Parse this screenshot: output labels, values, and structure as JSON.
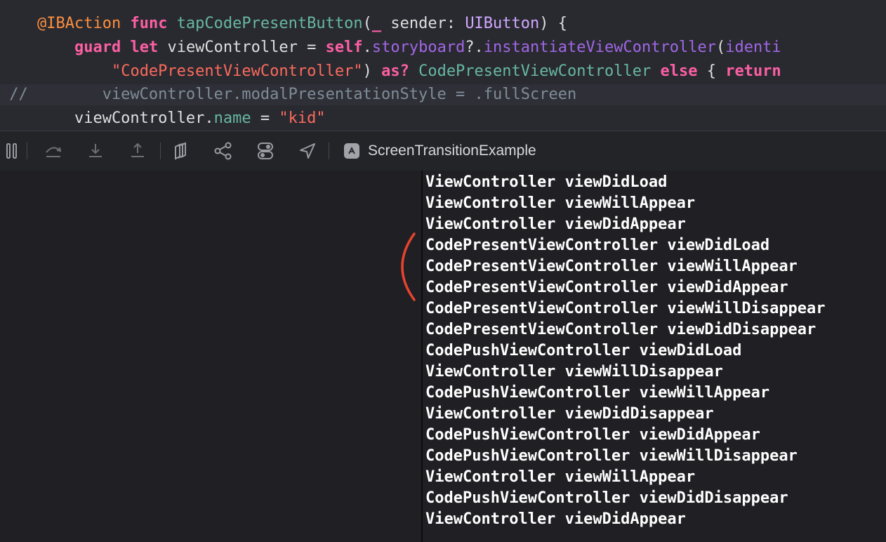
{
  "editor": {
    "lines": [
      {
        "tokens": [
          {
            "t": "    ",
            "c": "plain"
          },
          {
            "t": "@IBAction",
            "c": "attr"
          },
          {
            "t": " ",
            "c": "plain"
          },
          {
            "t": "func",
            "c": "kw"
          },
          {
            "t": " ",
            "c": "plain"
          },
          {
            "t": "tapCodePresentButton",
            "c": "fn"
          },
          {
            "t": "(",
            "c": "plain"
          },
          {
            "t": "_",
            "c": "kw"
          },
          {
            "t": " sender: ",
            "c": "plain"
          },
          {
            "t": "UIButton",
            "c": "type"
          },
          {
            "t": ") {",
            "c": "plain"
          }
        ]
      },
      {
        "tokens": [
          {
            "t": "        ",
            "c": "plain"
          },
          {
            "t": "guard",
            "c": "kw"
          },
          {
            "t": " ",
            "c": "plain"
          },
          {
            "t": "let",
            "c": "kw"
          },
          {
            "t": " viewController = ",
            "c": "plain"
          },
          {
            "t": "self",
            "c": "kw"
          },
          {
            "t": ".",
            "c": "plain"
          },
          {
            "t": "storyboard",
            "c": "prop"
          },
          {
            "t": "?.",
            "c": "plain"
          },
          {
            "t": "instantiateViewController",
            "c": "prop"
          },
          {
            "t": "(",
            "c": "plain"
          },
          {
            "t": "identi",
            "c": "prop"
          }
        ]
      },
      {
        "tokens": [
          {
            "t": "            ",
            "c": "plain"
          },
          {
            "t": "\"CodePresentViewController\"",
            "c": "str"
          },
          {
            "t": ") ",
            "c": "plain"
          },
          {
            "t": "as?",
            "c": "kw"
          },
          {
            "t": " ",
            "c": "plain"
          },
          {
            "t": "CodePresentViewController",
            "c": "fn"
          },
          {
            "t": " ",
            "c": "plain"
          },
          {
            "t": "else",
            "c": "kw"
          },
          {
            "t": " { ",
            "c": "plain"
          },
          {
            "t": "return",
            "c": "kw"
          }
        ]
      },
      {
        "current": true,
        "tokens": [
          {
            "t": " //        viewController.modalPresentationStyle = .fullScreen",
            "c": "cm"
          }
        ]
      },
      {
        "tokens": [
          {
            "t": "        viewController.",
            "c": "plain"
          },
          {
            "t": "name",
            "c": "fn"
          },
          {
            "t": " = ",
            "c": "plain"
          },
          {
            "t": "\"kid\"",
            "c": "str"
          }
        ]
      }
    ]
  },
  "debug_toolbar": {
    "buttons": [
      {
        "icon": "pause-icon",
        "name": "continue-pause-button"
      },
      {
        "icon": "step-over-icon",
        "name": "step-over-button"
      },
      {
        "icon": "step-into-icon",
        "name": "step-into-button"
      },
      {
        "icon": "step-out-icon",
        "name": "step-out-button"
      },
      {
        "icon": "view-hierarchy-icon",
        "name": "debug-view-hierarchy-button"
      },
      {
        "icon": "memory-graph-icon",
        "name": "debug-memory-graph-button"
      },
      {
        "icon": "environment-overrides-icon",
        "name": "environment-overrides-button"
      },
      {
        "icon": "location-icon",
        "name": "simulate-location-button"
      }
    ],
    "target": {
      "icon": "app-target-icon",
      "label": "ScreenTransitionExample"
    }
  },
  "console": {
    "lines": [
      "ViewController viewDidLoad",
      "ViewController viewWillAppear",
      "ViewController viewDidAppear",
      "CodePresentViewController viewDidLoad",
      "CodePresentViewController viewWillAppear",
      "CodePresentViewController viewDidAppear",
      "CodePresentViewController viewWillDisappear",
      "CodePresentViewController viewDidDisappear",
      "CodePushViewController viewDidLoad",
      "ViewController viewWillDisappear",
      "CodePushViewController viewWillAppear",
      "ViewController viewDidDisappear",
      "CodePushViewController viewDidAppear",
      "CodePushViewController viewWillDisappear",
      "ViewController viewWillAppear",
      "CodePushViewController viewDidDisappear",
      "ViewController viewDidAppear"
    ]
  },
  "annotation": {
    "color": "#e8432e"
  }
}
